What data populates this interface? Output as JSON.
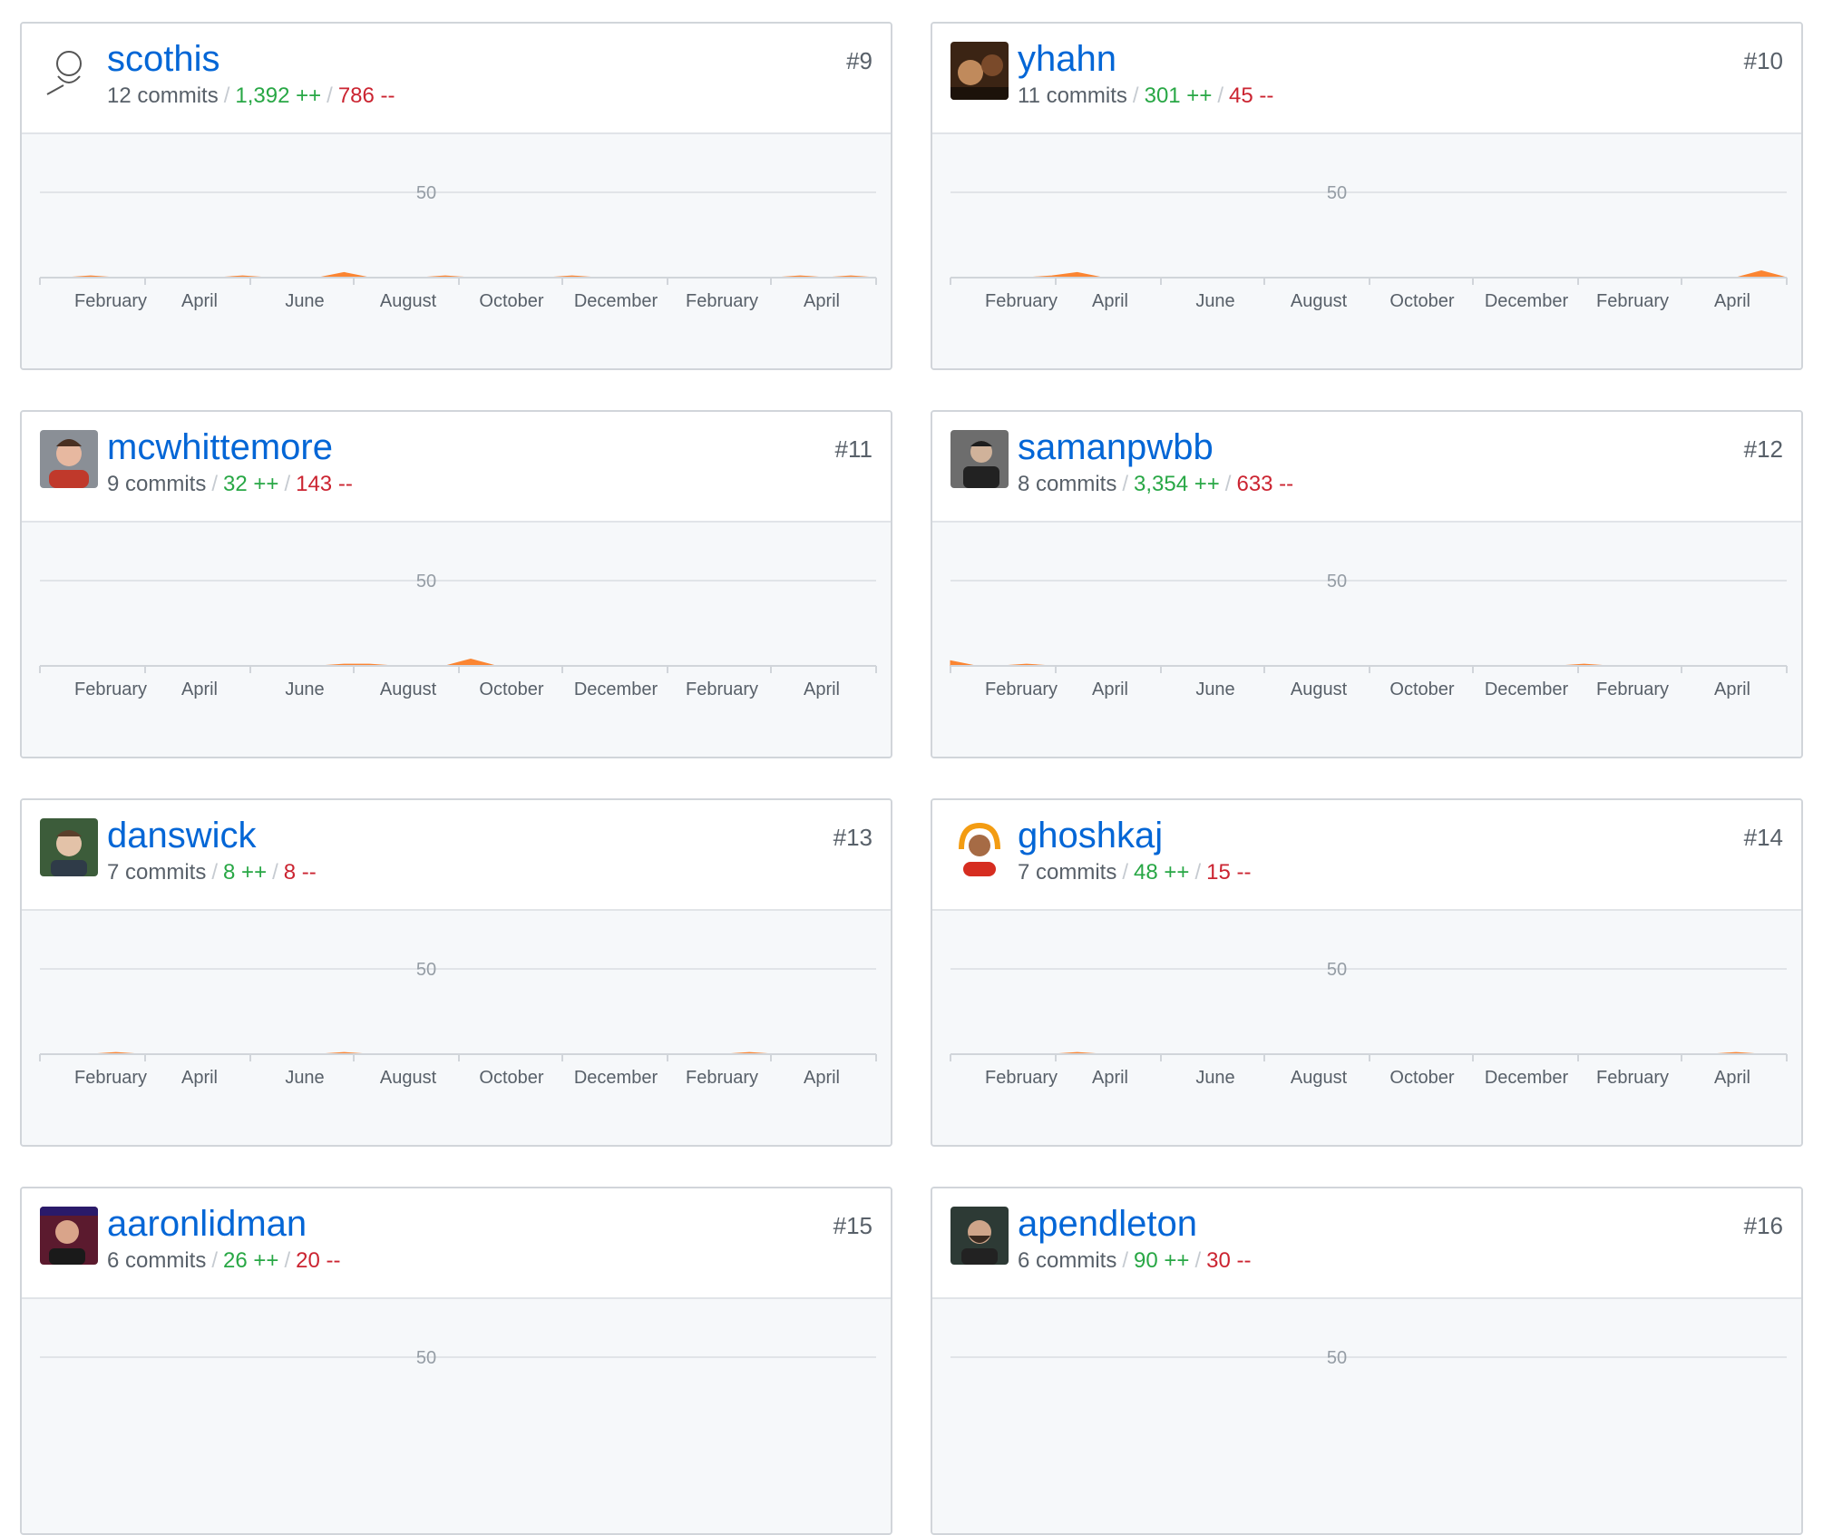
{
  "y_label": "50",
  "months": [
    "February",
    "April",
    "June",
    "August",
    "October",
    "December",
    "February",
    "April"
  ],
  "contributors": [
    {
      "login": "scothis",
      "rank": "#9",
      "commits": "12 commits",
      "additions": "1,392 ++",
      "deletions": "786 --",
      "avatar": "sketch",
      "chart_data": {
        "type": "area",
        "series": [
          {
            "values": [
              0,
              0,
              1,
              0,
              0,
              0,
              0,
              0,
              1,
              0,
              0,
              0,
              3,
              0,
              0,
              0,
              1,
              0,
              0,
              0,
              0,
              1,
              0,
              0,
              0,
              0,
              0,
              0,
              0,
              0,
              1,
              0,
              1,
              0
            ]
          }
        ],
        "ylim": [
          0,
          50
        ],
        "y_tick": 50
      }
    },
    {
      "login": "yhahn",
      "rank": "#10",
      "commits": "11 commits",
      "additions": "301 ++",
      "deletions": "45 --",
      "avatar": "dark-warm",
      "chart_data": {
        "type": "area",
        "series": [
          {
            "values": [
              0,
              0,
              0,
              0,
              1,
              3,
              0,
              0,
              0,
              0,
              0,
              0,
              0,
              0,
              0,
              0,
              0,
              0,
              0,
              0,
              0,
              0,
              0,
              0,
              0,
              0,
              0,
              0,
              0,
              0,
              0,
              0,
              4,
              0
            ]
          }
        ],
        "ylim": [
          0,
          50
        ],
        "y_tick": 50
      }
    },
    {
      "login": "mcwhittemore",
      "rank": "#11",
      "commits": "9 commits",
      "additions": "32 ++",
      "deletions": "143 --",
      "avatar": "red-shirt",
      "chart_data": {
        "type": "area",
        "series": [
          {
            "values": [
              0,
              0,
              0,
              0,
              0,
              0,
              0,
              0,
              0,
              0,
              0,
              0,
              1,
              1,
              0,
              0,
              0,
              4,
              0,
              0,
              0,
              0,
              0,
              0,
              0,
              0,
              0,
              0,
              0,
              0,
              0,
              0,
              0,
              0
            ]
          }
        ],
        "ylim": [
          0,
          50
        ],
        "y_tick": 50
      }
    },
    {
      "login": "samanpwbb",
      "rank": "#12",
      "commits": "8 commits",
      "additions": "3,354 ++",
      "deletions": "633 --",
      "avatar": "dark-portrait",
      "chart_data": {
        "type": "area",
        "series": [
          {
            "values": [
              3,
              0,
              0,
              1,
              0,
              0,
              0,
              0,
              0,
              0,
              0,
              0,
              0,
              0,
              0,
              0,
              0,
              0,
              0,
              0,
              0,
              0,
              0,
              0,
              0,
              1,
              0,
              0,
              0,
              0,
              0,
              0,
              0,
              0
            ]
          }
        ],
        "ylim": [
          0,
          50
        ],
        "y_tick": 50
      }
    },
    {
      "login": "danswick",
      "rank": "#13",
      "commits": "7 commits",
      "additions": "8 ++",
      "deletions": "8 --",
      "avatar": "green-bg",
      "chart_data": {
        "type": "area",
        "series": [
          {
            "values": [
              0,
              0,
              0,
              1,
              0,
              0,
              0,
              0,
              0,
              0,
              0,
              0,
              1,
              0,
              0,
              0,
              0,
              0,
              0,
              0,
              0,
              0,
              0,
              0,
              0,
              0,
              0,
              0,
              1,
              0,
              0,
              0,
              0,
              0
            ]
          }
        ],
        "ylim": [
          0,
          50
        ],
        "y_tick": 50
      }
    },
    {
      "login": "ghoshkaj",
      "rank": "#14",
      "commits": "7 commits",
      "additions": "48 ++",
      "deletions": "15 --",
      "avatar": "headphones",
      "chart_data": {
        "type": "area",
        "series": [
          {
            "values": [
              0,
              0,
              0,
              0,
              0,
              1,
              0,
              0,
              0,
              0,
              0,
              0,
              0,
              0,
              0,
              0,
              0,
              0,
              0,
              0,
              0,
              0,
              0,
              0,
              0,
              0,
              0,
              0,
              0,
              0,
              0,
              1,
              0,
              0
            ]
          }
        ],
        "ylim": [
          0,
          50
        ],
        "y_tick": 50
      }
    },
    {
      "login": "aaronlidman",
      "rank": "#15",
      "commits": "6 commits",
      "additions": "26 ++",
      "deletions": "20 --",
      "avatar": "stage",
      "chart_data": {
        "type": "area",
        "series": [
          {
            "values": []
          }
        ],
        "ylim": [
          0,
          50
        ],
        "y_tick": 50
      }
    },
    {
      "login": "apendleton",
      "rank": "#16",
      "commits": "6 commits",
      "additions": "90 ++",
      "deletions": "30 --",
      "avatar": "beard",
      "chart_data": {
        "type": "area",
        "series": [
          {
            "values": []
          }
        ],
        "ylim": [
          0,
          50
        ],
        "y_tick": 50
      }
    }
  ]
}
